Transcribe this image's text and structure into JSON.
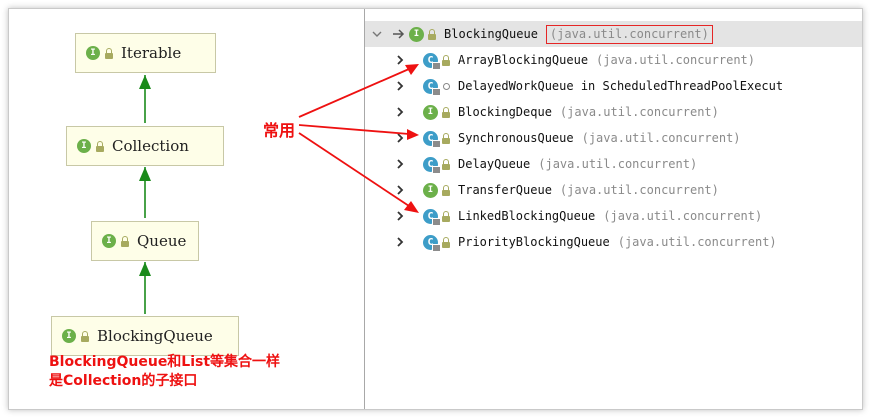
{
  "colors": {
    "annotation": "#ee1111",
    "interface_badge": "#6cb04a",
    "class_badge": "#3d9dc8",
    "node_bg": "#fefee8",
    "diagram_arrow": "#1a8a1a",
    "header_bg": "#e4e4e4"
  },
  "icons": {
    "interface": "I",
    "class": "C"
  },
  "diagram": {
    "nodes": {
      "iterable": "Iterable",
      "collection": "Collection",
      "queue": "Queue",
      "blocking_queue": "BlockingQueue"
    },
    "note_line1": "BlockingQueue和List等集合一样",
    "note_line2": "是Collection的子接口"
  },
  "annotation_label": "常用",
  "tree": {
    "header": {
      "name": "BlockingQueue",
      "package": "(java.util.concurrent)"
    },
    "items": [
      {
        "kind": "class",
        "name": "ArrayBlockingQueue",
        "package": "(java.util.concurrent)"
      },
      {
        "kind": "class-inner",
        "name": "DelayedWorkQueue in ScheduledThreadPoolExecut",
        "package": ""
      },
      {
        "kind": "interface",
        "name": "BlockingDeque",
        "package": "(java.util.concurrent)"
      },
      {
        "kind": "class",
        "name": "SynchronousQueue",
        "package": "(java.util.concurrent)"
      },
      {
        "kind": "class",
        "name": "DelayQueue",
        "package": "(java.util.concurrent)"
      },
      {
        "kind": "interface",
        "name": "TransferQueue",
        "package": "(java.util.concurrent)"
      },
      {
        "kind": "class",
        "name": "LinkedBlockingQueue",
        "package": "(java.util.concurrent)"
      },
      {
        "kind": "class",
        "name": "PriorityBlockingQueue",
        "package": "(java.util.concurrent)"
      }
    ]
  }
}
